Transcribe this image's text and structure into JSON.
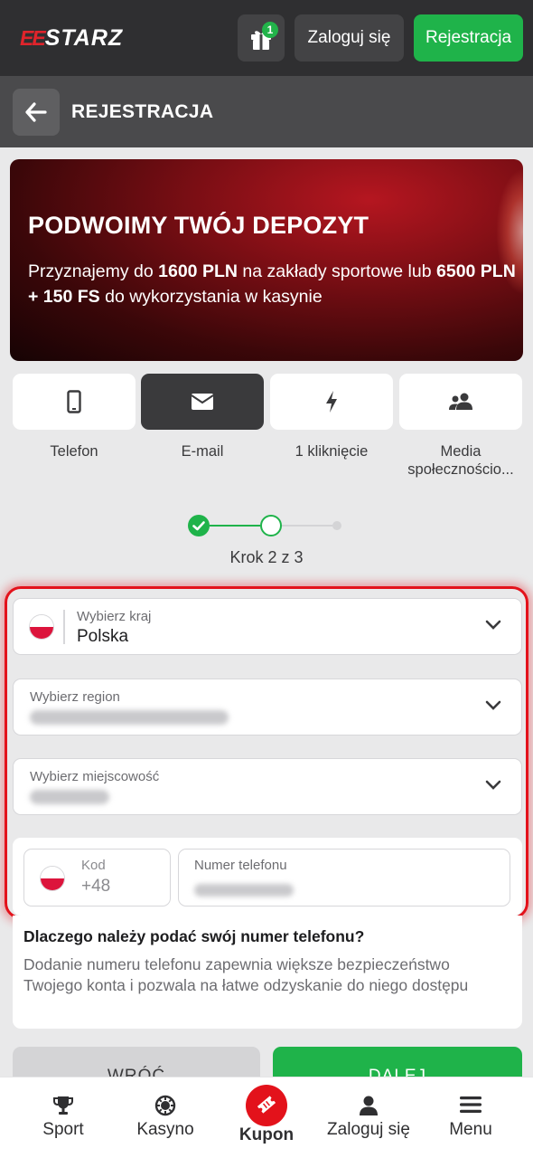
{
  "header": {
    "logo_prefix": "EE",
    "logo_text": "STARZ",
    "gift_badge": "1",
    "login_label": "Zaloguj się",
    "register_label": "Rejestracja"
  },
  "page": {
    "title": "REJESTRACJA"
  },
  "banner": {
    "headline": "PODWOIMY TWÓJ DEPOZYT",
    "text_1": "Przyznajemy do ",
    "amount_1": "1600 PLN",
    "text_2": " na zakłady sportowe lub ",
    "amount_2": "6500 PLN + 150 FS",
    "text_3": " do wykorzystania w kasynie"
  },
  "methods": [
    {
      "label": "Telefon",
      "icon": "phone-icon",
      "active": false
    },
    {
      "label": "E-mail",
      "icon": "envelope-icon",
      "active": true
    },
    {
      "label": "1 kliknięcie",
      "icon": "lightning-icon",
      "active": false
    },
    {
      "label": "Media społecznościo...",
      "icon": "users-icon",
      "active": false
    }
  ],
  "stepper": {
    "text": "Krok 2 z 3",
    "current": 2,
    "total": 3
  },
  "form": {
    "country": {
      "label": "Wybierz kraj",
      "value": "Polska"
    },
    "region": {
      "label": "Wybierz region"
    },
    "city": {
      "label": "Wybierz miejscowość"
    },
    "phone": {
      "code_label": "Kod",
      "code_value": "+48",
      "number_label": "Numer telefonu"
    }
  },
  "info": {
    "question": "Dlaczego należy podać swój numer telefonu?",
    "answer": "Dodanie numeru telefonu zapewnia większe bezpieczeństwo Twojego konta i pozwala na łatwe odzyskanie do niego dostępu"
  },
  "actions": {
    "back_label": "WRÓĆ",
    "next_label": "DALEJ"
  },
  "bottom_nav": [
    {
      "label": "Sport",
      "icon": "trophy-icon"
    },
    {
      "label": "Kasyno",
      "icon": "casino-chip-icon"
    },
    {
      "label": "Kupon",
      "icon": "ticket-icon"
    },
    {
      "label": "Zaloguj się",
      "icon": "user-icon"
    },
    {
      "label": "Menu",
      "icon": "hamburger-icon"
    }
  ],
  "colors": {
    "accent_green": "#1fb34a",
    "brand_red": "#e3121b",
    "topbar": "#2f2f31"
  }
}
